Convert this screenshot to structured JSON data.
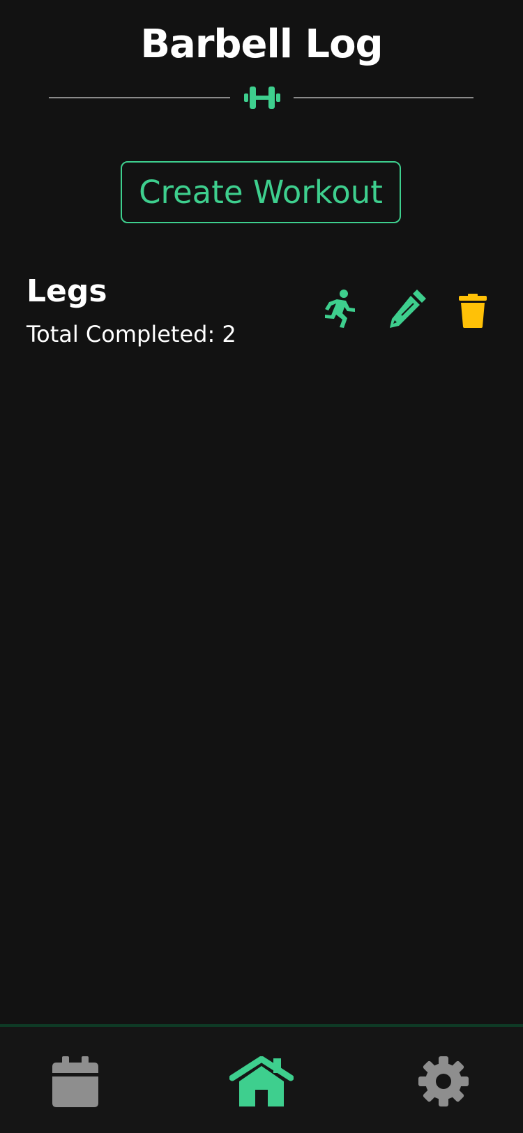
{
  "app": {
    "title": "Barbell Log"
  },
  "header": {
    "logo_icon": "dumbbell-icon"
  },
  "actions": {
    "create_label": "Create Workout"
  },
  "workouts": [
    {
      "name": "Legs",
      "completed_text": "Total Completed: 2",
      "icons": [
        "running-icon",
        "pencil-icon",
        "trash-icon"
      ]
    }
  ],
  "bottom_nav": {
    "items": [
      {
        "icon": "calendar-icon",
        "active": false
      },
      {
        "icon": "home-icon",
        "active": true
      },
      {
        "icon": "gear-icon",
        "active": false
      }
    ]
  },
  "colors": {
    "background": "#121212",
    "accent": "#3ecf8e",
    "danger": "#ffc107",
    "inactive_nav": "#8e8e8e",
    "text": "#ffffff"
  }
}
